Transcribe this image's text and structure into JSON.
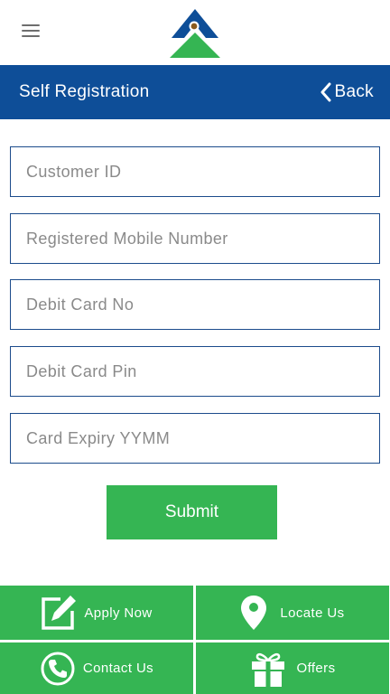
{
  "icons": {
    "menu": "hamburger-icon",
    "logo": "bank-logo",
    "back": "chevron-left-icon",
    "apply": "edit-icon",
    "locate": "location-pin-icon",
    "contact": "phone-icon",
    "offers": "gift-icon"
  },
  "colors": {
    "header_bg": "#0e4e98",
    "accent_green": "#35b553",
    "field_border": "#1c4c8c"
  },
  "header": {
    "title": "Self Registration",
    "back_label": "Back"
  },
  "form": {
    "customer_id": {
      "placeholder": "Customer ID",
      "value": ""
    },
    "mobile": {
      "placeholder": "Registered Mobile Number",
      "value": ""
    },
    "card_no": {
      "placeholder": "Debit Card No",
      "value": ""
    },
    "card_pin": {
      "placeholder": "Debit Card Pin",
      "value": ""
    },
    "expiry": {
      "placeholder": "Card Expiry YYMM",
      "value": ""
    },
    "submit_label": "Submit"
  },
  "bottom_nav": {
    "apply": "Apply Now",
    "locate": "Locate Us",
    "contact": "Contact Us",
    "offers": "Offers"
  }
}
